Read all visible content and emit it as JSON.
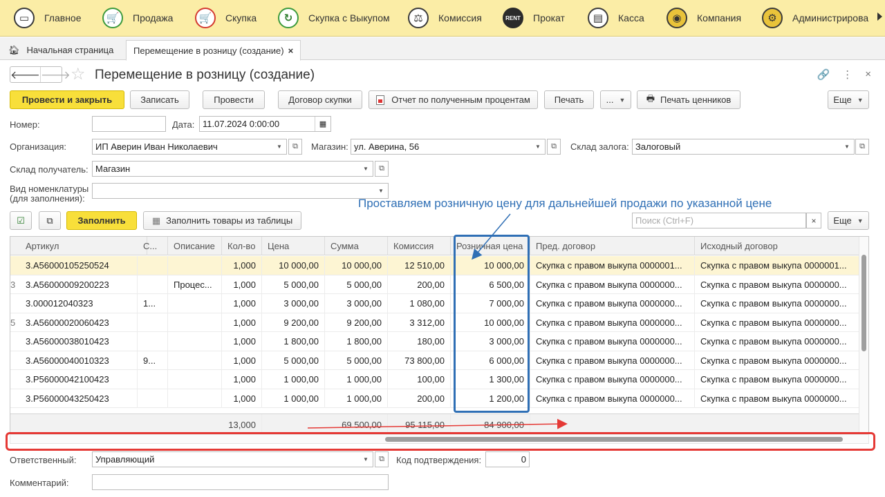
{
  "sections": [
    {
      "label": "Главное",
      "icon": "home-icon"
    },
    {
      "label": "Продажа",
      "icon": "cart-icon"
    },
    {
      "label": "Скупка",
      "icon": "buy-cart-icon"
    },
    {
      "label": "Скупка с Выкупом",
      "icon": "refresh-icon"
    },
    {
      "label": "Комиссия",
      "icon": "scales-icon"
    },
    {
      "label": "Прокат",
      "icon": "rent-icon"
    },
    {
      "label": "Касса",
      "icon": "cash-register-icon"
    },
    {
      "label": "Компания",
      "icon": "company-icon"
    },
    {
      "label": "Администрирова",
      "icon": "gears-icon"
    }
  ],
  "tabs": {
    "home": "Начальная страница",
    "active": "Перемещение в розницу (создание)",
    "close": "×"
  },
  "header": {
    "title": "Перемещение в розницу (создание)",
    "back": "🡐",
    "forward": "🡒",
    "star": "☆",
    "link": "🔗",
    "more": "⋮",
    "close": "×"
  },
  "toolbar": {
    "post_close": "Провести и закрыть",
    "write": "Записать",
    "post": "Провести",
    "contract": "Договор скупки",
    "report": "Отчет по полученным процентам",
    "print": "Печать",
    "dots": "...",
    "price_tags": "Печать ценников",
    "more": "Еще"
  },
  "form": {
    "number_label": "Номер:",
    "number_value": "",
    "date_label": "Дата:",
    "date_value": "11.07.2024  0:00:00",
    "org_label": "Организация:",
    "org_value": "ИП Аверин Иван Николаевич",
    "store_label": "Магазин:",
    "store_value": "ул. Аверина, 56",
    "pledge_label": "Склад залога:",
    "pledge_value": "Залоговый",
    "receiver_label": "Склад получатель:",
    "receiver_value": "Магазин",
    "nomen_label_1": "Вид номенклатуры",
    "nomen_label_2": "(для заполнения):",
    "nomen_value": "",
    "responsible_label": "Ответственный:",
    "responsible_value": "Управляющий",
    "code_label": "Код подтверждения:",
    "code_value": "0",
    "comment_label": "Комментарий:",
    "comment_value": ""
  },
  "table_toolbar": {
    "fill": "Заполнить",
    "fill_from_table": "Заполнить товары из таблицы",
    "search_placeholder": "Поиск (Ctrl+F)",
    "clear": "×",
    "more": "Еще"
  },
  "table": {
    "columns": [
      "Артикул",
      "С...",
      "Описание",
      "Кол-во",
      "Цена",
      "Сумма",
      "Комиссия",
      "Розничная цена",
      "Пред. договор",
      "Исходный договор"
    ],
    "rows": [
      {
        "lead": "",
        "article": "3.A56000105250524",
        "s": "",
        "desc": "",
        "qty": "1,000",
        "price": "10 000,00",
        "sum": "10 000,00",
        "commission": "12 510,00",
        "retail": "10 000,00",
        "prev": "Скупка с правом выкупа 0000001...",
        "orig": "Скупка с правом выкупа 0000001..."
      },
      {
        "lead": "3",
        "article": "3.A56000009200223",
        "s": "",
        "desc": "Процес...",
        "qty": "1,000",
        "price": "5 000,00",
        "sum": "5 000,00",
        "commission": "200,00",
        "retail": "6 500,00",
        "prev": "Скупка с правом выкупа 0000000...",
        "orig": "Скупка с правом выкупа 0000000..."
      },
      {
        "lead": "",
        "article": "3.000012040323",
        "s": "1...",
        "desc": "",
        "qty": "1,000",
        "price": "3 000,00",
        "sum": "3 000,00",
        "commission": "1 080,00",
        "retail": "7 000,00",
        "prev": "Скупка с правом выкупа 0000000...",
        "orig": "Скупка с правом выкупа 0000000..."
      },
      {
        "lead": "5",
        "article": "3.A56000020060423",
        "s": "",
        "desc": "",
        "qty": "1,000",
        "price": "9 200,00",
        "sum": "9 200,00",
        "commission": "3 312,00",
        "retail": "10 000,00",
        "prev": "Скупка с правом выкупа 0000000...",
        "orig": "Скупка с правом выкупа 0000000..."
      },
      {
        "lead": "",
        "article": "3.A56000038010423",
        "s": "",
        "desc": "",
        "qty": "1,000",
        "price": "1 800,00",
        "sum": "1 800,00",
        "commission": "180,00",
        "retail": "3 000,00",
        "prev": "Скупка с правом выкупа 0000000...",
        "orig": "Скупка с правом выкупа 0000000..."
      },
      {
        "lead": "",
        "article": "3.A56000040010323",
        "s": "9...",
        "desc": "",
        "qty": "1,000",
        "price": "5 000,00",
        "sum": "5 000,00",
        "commission": "73 800,00",
        "retail": "6 000,00",
        "prev": "Скупка с правом выкупа 0000000...",
        "orig": "Скупка с правом выкупа 0000000..."
      },
      {
        "lead": "",
        "article": "3.P56000042100423",
        "s": "",
        "desc": "",
        "qty": "1,000",
        "price": "1 000,00",
        "sum": "1 000,00",
        "commission": "100,00",
        "retail": "1 300,00",
        "prev": "Скупка с правом выкупа 0000000...",
        "orig": "Скупка с правом выкупа 0000000..."
      },
      {
        "lead": "",
        "article": "3.P56000043250423",
        "s": "",
        "desc": "",
        "qty": "1,000",
        "price": "1 000,00",
        "sum": "1 000,00",
        "commission": "200,00",
        "retail": "1 200,00",
        "prev": "Скупка с правом выкупа 0000000...",
        "orig": "Скупка с правом выкупа 0000000..."
      }
    ],
    "totals": {
      "qty": "13,000",
      "sum": "69 500,00",
      "commission": "95 115,00",
      "retail": "84 900,00"
    }
  },
  "annotation": {
    "callout": "Проставляем розничную цену для дальнейшей продажи по указанной цене",
    "color_blue": "#2f6fb5",
    "color_red": "#e53935"
  },
  "colors": {
    "section_bar": "#fbeda6",
    "primary_button": "#f8df3a",
    "selected_row": "#fdf5d3"
  }
}
